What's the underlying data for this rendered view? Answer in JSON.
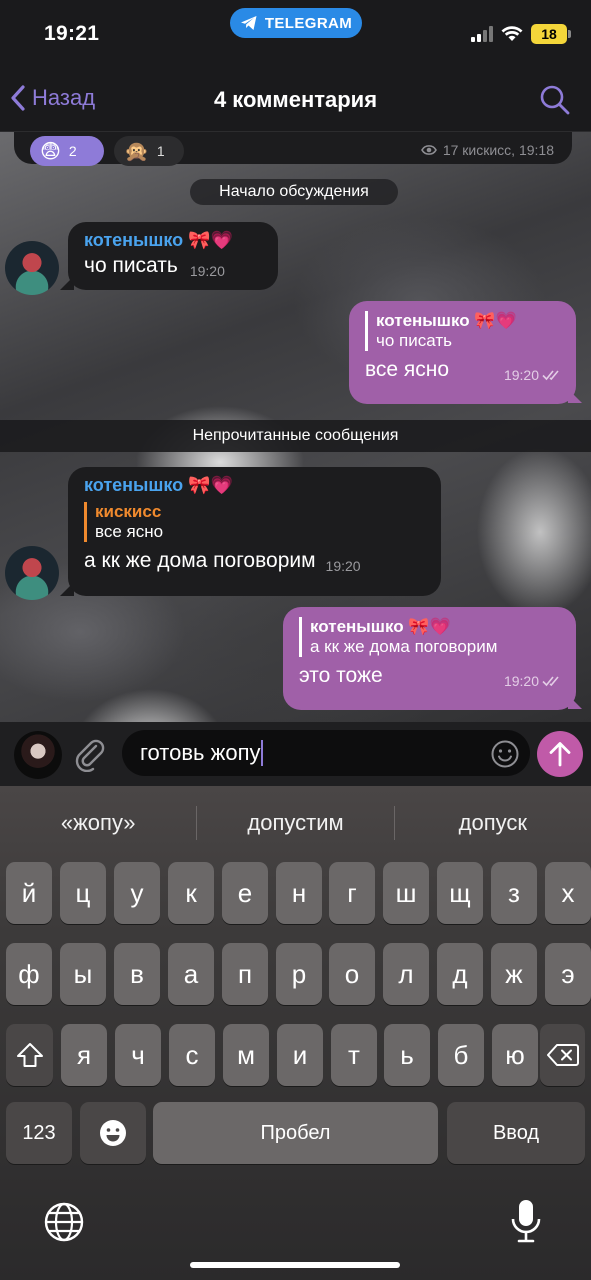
{
  "status_bar": {
    "time": "19:21",
    "app_pill": "TELEGRAM",
    "battery": "18"
  },
  "nav": {
    "back_label": "Назад",
    "title": "4 комментария"
  },
  "previous_post": {
    "reactions": [
      {
        "emoji": "😨",
        "count": "2"
      },
      {
        "emoji": "🙊",
        "count": "1"
      }
    ],
    "views_meta": "17 кискисс, 19:18"
  },
  "chat": {
    "discussion_start": "Начало обсуждения",
    "unread_label": "Непрочитанные сообщения",
    "messages": [
      {
        "sender": "котенышко 🎀💗",
        "text": "чо писать",
        "time": "19:20"
      },
      {
        "reply_name": "котенышко 🎀💗",
        "reply_text": "чо писать",
        "text": "все ясно",
        "time": "19:20"
      },
      {
        "sender": "котенышко 🎀💗",
        "reply_name": "кискисс",
        "reply_text": "все ясно",
        "text": "а кк же дома поговорим",
        "time": "19:20"
      },
      {
        "reply_name": "котенышко 🎀💗",
        "reply_text": "а кк же дома поговорим",
        "text": "это тоже",
        "time": "19:20"
      }
    ]
  },
  "composer": {
    "value": "готовь жопу"
  },
  "keyboard": {
    "suggestions": [
      "«жопу»",
      "допустим",
      "допуск"
    ],
    "row1": [
      "й",
      "ц",
      "у",
      "к",
      "е",
      "н",
      "г",
      "ш",
      "щ",
      "з",
      "х"
    ],
    "row2": [
      "ф",
      "ы",
      "в",
      "а",
      "п",
      "р",
      "о",
      "л",
      "д",
      "ж",
      "э"
    ],
    "row3": [
      "я",
      "ч",
      "с",
      "м",
      "и",
      "т",
      "ь",
      "б",
      "ю"
    ],
    "numbers_key": "123",
    "space_key": "Пробел",
    "return_key": "Ввод"
  },
  "colors": {
    "accent": "#8e7bd8",
    "outgoing_bubble": "#a060a8",
    "sender_name": "#4aa3ee",
    "reply_orange": "#f08a2e",
    "send_button": "#c05aa8"
  }
}
